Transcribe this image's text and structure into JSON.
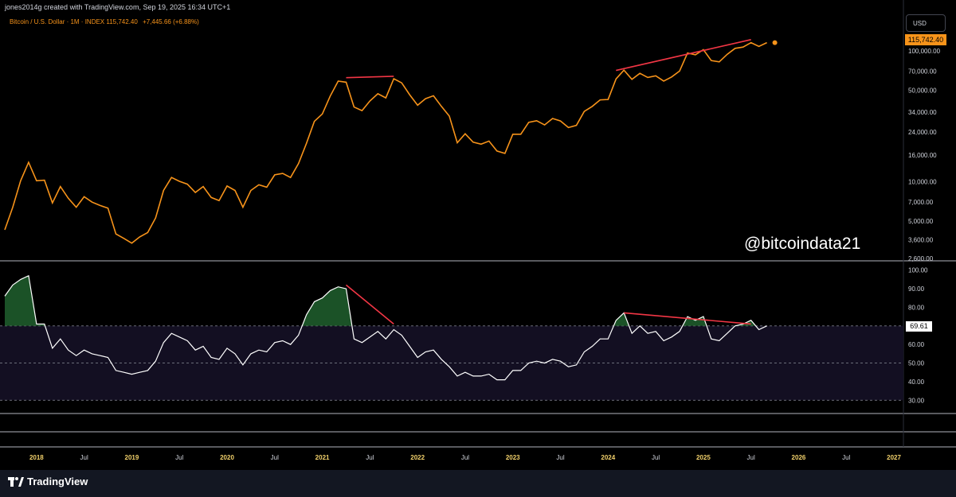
{
  "header": {
    "credit": "jones2014g created with TradingView.com, Sep 19, 2025 16:34 UTC+1",
    "symbol": "Bitcoin / U.S. Dollar · 1M · INDEX",
    "price": "115,742.40",
    "change": "+7,445.66 (+6.88%)"
  },
  "currency_button": "USD",
  "price_label": "115,742.40",
  "rsi_label": "69.61",
  "watermark": "@bitcoindata21",
  "footer": {
    "brand": "TradingView"
  },
  "colors": {
    "price": "#f7931a",
    "rsi": "#ffffff",
    "trendline": "#f23645",
    "overbought_fill": "#1e5b2b",
    "band": "#130f22"
  },
  "chart_data": [
    {
      "type": "line",
      "name": "price",
      "y_scale": "log",
      "ylim": [
        2600,
        140000
      ],
      "yticks": [
        2600,
        3600,
        5000,
        7000,
        10000,
        16000,
        24000,
        34000,
        50000,
        70000,
        100000
      ],
      "ytick_labels": [
        "2,600.00",
        "3,600.00",
        "5,000.00",
        "7,000.00",
        "10,000.00",
        "16,000.00",
        "24,000.00",
        "34,000.00",
        "50,000.00",
        "70,000.00",
        "100,000.00"
      ],
      "x": [
        "2017-09",
        "2017-10",
        "2017-11",
        "2017-12",
        "2018-01",
        "2018-02",
        "2018-03",
        "2018-04",
        "2018-05",
        "2018-06",
        "2018-07",
        "2018-08",
        "2018-09",
        "2018-10",
        "2018-11",
        "2018-12",
        "2019-01",
        "2019-02",
        "2019-03",
        "2019-04",
        "2019-05",
        "2019-06",
        "2019-07",
        "2019-08",
        "2019-09",
        "2019-10",
        "2019-11",
        "2019-12",
        "2020-01",
        "2020-02",
        "2020-03",
        "2020-04",
        "2020-05",
        "2020-06",
        "2020-07",
        "2020-08",
        "2020-09",
        "2020-10",
        "2020-11",
        "2020-12",
        "2021-01",
        "2021-02",
        "2021-03",
        "2021-04",
        "2021-05",
        "2021-06",
        "2021-07",
        "2021-08",
        "2021-09",
        "2021-10",
        "2021-11",
        "2021-12",
        "2022-01",
        "2022-02",
        "2022-03",
        "2022-04",
        "2022-05",
        "2022-06",
        "2022-07",
        "2022-08",
        "2022-09",
        "2022-10",
        "2022-11",
        "2022-12",
        "2023-01",
        "2023-02",
        "2023-03",
        "2023-04",
        "2023-05",
        "2023-06",
        "2023-07",
        "2023-08",
        "2023-09",
        "2023-10",
        "2023-11",
        "2023-12",
        "2024-01",
        "2024-02",
        "2024-03",
        "2024-04",
        "2024-05",
        "2024-06",
        "2024-07",
        "2024-08",
        "2024-09",
        "2024-10",
        "2024-11",
        "2024-12",
        "2025-01",
        "2025-02",
        "2025-03",
        "2025-04",
        "2025-05",
        "2025-06",
        "2025-07",
        "2025-08",
        "2025-09"
      ],
      "values": [
        4300,
        6400,
        10200,
        14100,
        10200,
        10300,
        6900,
        9200,
        7500,
        6400,
        7700,
        7000,
        6600,
        6300,
        4000,
        3700,
        3400,
        3800,
        4100,
        5300,
        8600,
        10800,
        10100,
        9600,
        8300,
        9200,
        7600,
        7200,
        9300,
        8600,
        6400,
        8600,
        9500,
        9100,
        11300,
        11600,
        10800,
        13800,
        19700,
        29000,
        33000,
        45200,
        58800,
        57700,
        37300,
        35000,
        41500,
        47100,
        43800,
        61300,
        57000,
        46300,
        38500,
        43200,
        45500,
        37700,
        31800,
        19900,
        23300,
        20100,
        19400,
        20500,
        17200,
        16500,
        23100,
        23100,
        28500,
        29300,
        27200,
        30500,
        29200,
        26000,
        27000,
        34500,
        37700,
        42300,
        42600,
        61200,
        71300,
        60700,
        67500,
        62700,
        64600,
        58900,
        63300,
        70200,
        96400,
        93400,
        102400,
        84400,
        82500,
        94200,
        104600,
        107100,
        115700,
        108200,
        115700
      ]
    },
    {
      "type": "line",
      "name": "rsi",
      "ylim": [
        25,
        102
      ],
      "yticks": [
        30,
        40,
        50,
        60,
        70,
        80,
        90,
        100
      ],
      "ytick_labels": [
        "30.00",
        "40.00",
        "50.00",
        "60.00",
        "70.00",
        "80.00",
        "90.00",
        "100.00"
      ],
      "bands": [
        30,
        50,
        70
      ],
      "x": [
        "2017-09",
        "2017-10",
        "2017-11",
        "2017-12",
        "2018-01",
        "2018-02",
        "2018-03",
        "2018-04",
        "2018-05",
        "2018-06",
        "2018-07",
        "2018-08",
        "2018-09",
        "2018-10",
        "2018-11",
        "2018-12",
        "2019-01",
        "2019-02",
        "2019-03",
        "2019-04",
        "2019-05",
        "2019-06",
        "2019-07",
        "2019-08",
        "2019-09",
        "2019-10",
        "2019-11",
        "2019-12",
        "2020-01",
        "2020-02",
        "2020-03",
        "2020-04",
        "2020-05",
        "2020-06",
        "2020-07",
        "2020-08",
        "2020-09",
        "2020-10",
        "2020-11",
        "2020-12",
        "2021-01",
        "2021-02",
        "2021-03",
        "2021-04",
        "2021-05",
        "2021-06",
        "2021-07",
        "2021-08",
        "2021-09",
        "2021-10",
        "2021-11",
        "2021-12",
        "2022-01",
        "2022-02",
        "2022-03",
        "2022-04",
        "2022-05",
        "2022-06",
        "2022-07",
        "2022-08",
        "2022-09",
        "2022-10",
        "2022-11",
        "2022-12",
        "2023-01",
        "2023-02",
        "2023-03",
        "2023-04",
        "2023-05",
        "2023-06",
        "2023-07",
        "2023-08",
        "2023-09",
        "2023-10",
        "2023-11",
        "2023-12",
        "2024-01",
        "2024-02",
        "2024-03",
        "2024-04",
        "2024-05",
        "2024-06",
        "2024-07",
        "2024-08",
        "2024-09",
        "2024-10",
        "2024-11",
        "2024-12",
        "2025-01",
        "2025-02",
        "2025-03",
        "2025-04",
        "2025-05",
        "2025-06",
        "2025-07",
        "2025-08",
        "2025-09"
      ],
      "values": [
        86,
        92,
        95,
        97,
        71,
        71,
        58,
        63,
        57,
        54,
        57,
        55,
        54,
        53,
        46,
        45,
        44,
        45,
        46,
        51,
        61,
        66,
        64,
        62,
        57,
        59,
        53,
        52,
        58,
        55,
        49,
        55,
        57,
        56,
        61,
        62,
        60,
        65,
        76,
        83,
        85,
        89,
        91,
        90,
        63,
        61,
        64,
        67,
        63,
        68,
        65,
        59,
        53,
        56,
        57,
        52,
        48,
        43,
        45,
        43,
        43,
        44,
        41,
        41,
        46,
        46,
        50,
        51,
        50,
        52,
        51,
        48,
        49,
        56,
        59,
        63,
        63,
        73,
        77,
        66,
        70,
        66,
        67,
        62,
        64,
        67,
        75,
        73,
        75,
        63,
        62,
        66,
        70,
        71,
        73,
        68,
        70
      ]
    }
  ],
  "x_axis_labels": [
    {
      "label": "2018",
      "x": "2018-01",
      "year": true
    },
    {
      "label": "Jul",
      "x": "2018-07",
      "year": false
    },
    {
      "label": "2019",
      "x": "2019-01",
      "year": true
    },
    {
      "label": "Jul",
      "x": "2019-07",
      "year": false
    },
    {
      "label": "2020",
      "x": "2020-01",
      "year": true
    },
    {
      "label": "Jul",
      "x": "2020-07",
      "year": false
    },
    {
      "label": "2021",
      "x": "2021-01",
      "year": true
    },
    {
      "label": "Jul",
      "x": "2021-07",
      "year": false
    },
    {
      "label": "2022",
      "x": "2022-01",
      "year": true
    },
    {
      "label": "Jul",
      "x": "2022-07",
      "year": false
    },
    {
      "label": "2023",
      "x": "2023-01",
      "year": true
    },
    {
      "label": "Jul",
      "x": "2023-07",
      "year": false
    },
    {
      "label": "2024",
      "x": "2024-01",
      "year": true
    },
    {
      "label": "Jul",
      "x": "2024-07",
      "year": false
    },
    {
      "label": "2025",
      "x": "2025-01",
      "year": true
    },
    {
      "label": "Jul",
      "x": "2025-07",
      "year": false
    },
    {
      "label": "2026",
      "x": "2026-01",
      "year": true
    },
    {
      "label": "Jul",
      "x": "2026-07",
      "year": false
    },
    {
      "label": "2027",
      "x": "2027-01",
      "year": true
    }
  ],
  "trendlines": {
    "price": [
      {
        "from": [
          "2021-04",
          62500
        ],
        "to": [
          "2021-10",
          64000
        ]
      },
      {
        "from": [
          "2024-02",
          71000
        ],
        "to": [
          "2025-07",
          122000
        ]
      }
    ],
    "rsi": [
      {
        "from": [
          "2021-04",
          92
        ],
        "to": [
          "2021-10",
          71
        ]
      },
      {
        "from": [
          "2024-03",
          77
        ],
        "to": [
          "2025-07",
          71
        ]
      }
    ]
  }
}
